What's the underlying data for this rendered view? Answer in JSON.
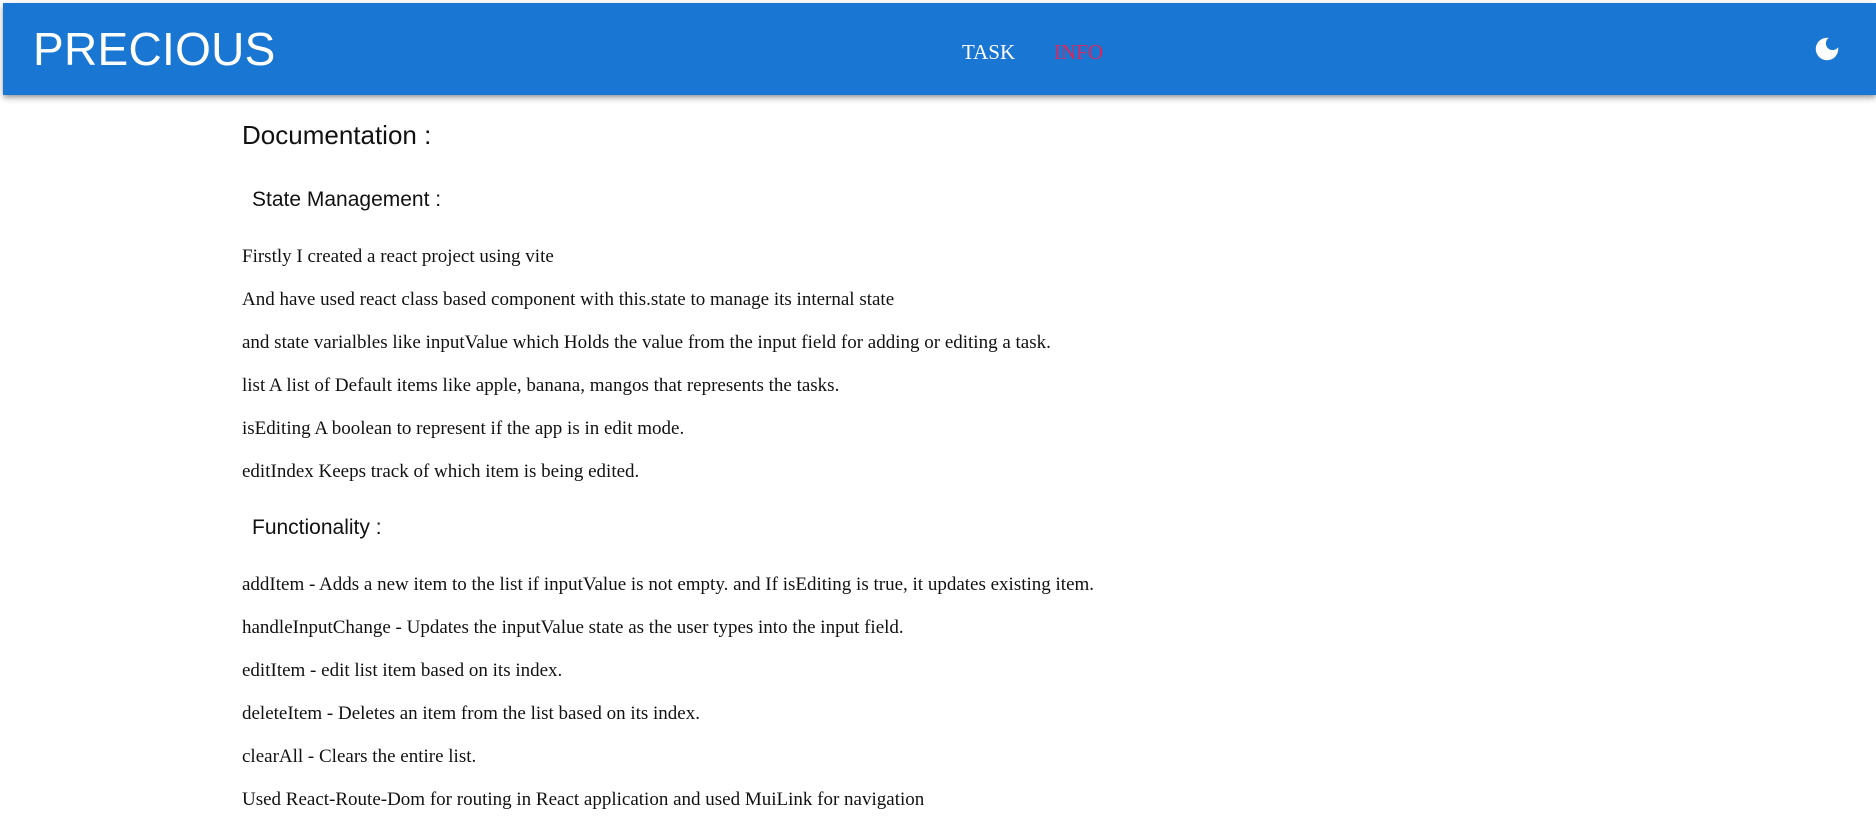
{
  "header": {
    "brand": "PRECIOUS",
    "nav": {
      "task": "TASK",
      "info": "INFO"
    },
    "theme_toggle_icon": "moon-icon",
    "colors": {
      "appbar": "#1976d2",
      "active_link": "#e0255a",
      "link": "#ffffff"
    }
  },
  "main": {
    "title": "Documentation :",
    "sections": [
      {
        "title": "State Management :",
        "paragraphs": [
          "Firstly I created a react project using vite",
          "And have used react class based component with this.state to manage its internal state",
          "and state varialbles like inputValue which Holds the value from the input field for adding or editing a task.",
          "list A list of Default items like apple, banana, mangos that represents the tasks.",
          "isEditing A boolean to represent if the app is in edit mode.",
          "editIndex Keeps track of which item is being edited."
        ]
      },
      {
        "title": "Functionality :",
        "paragraphs": [
          "addItem - Adds a new item to the list if inputValue is not empty. and If isEditing is true, it updates existing item.",
          "handleInputChange - Updates the inputValue state as the user types into the input field.",
          "editItem - edit list item based on its index.",
          "deleteItem - Deletes an item from the list based on its index.",
          "clearAll - Clears the entire list.",
          "Used React-Route-Dom for routing in React application and used MuiLink for navigation"
        ]
      }
    ]
  }
}
